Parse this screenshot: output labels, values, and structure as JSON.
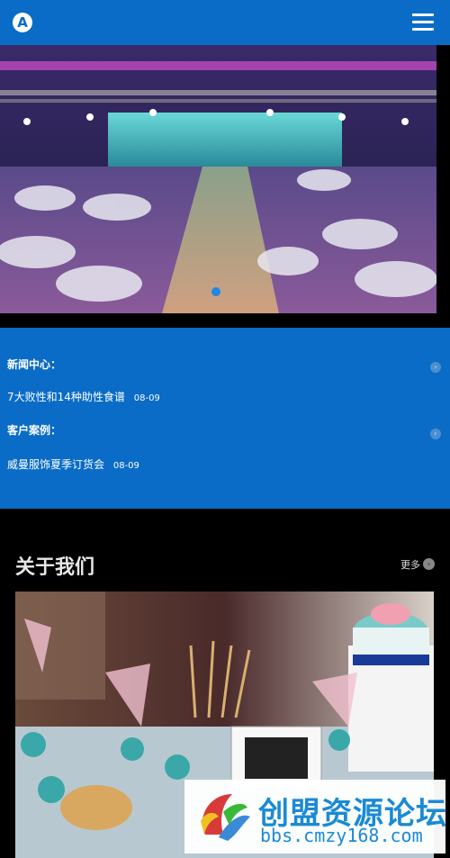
{
  "header": {
    "logo_letter": "A"
  },
  "news_block": {
    "news_center_label": "新闻中心：",
    "news_item": {
      "title": "7大败性和14种助性食谱",
      "date": "08-09"
    },
    "cases_label": "客户案例：",
    "case_item": {
      "title": "威曼服饰夏季订货会",
      "date": "08-09"
    }
  },
  "about": {
    "title": "关于我们",
    "more_label": "更多"
  },
  "watermark": {
    "title": "创盟资源论坛",
    "url": "bbs.cmzy168.com"
  },
  "colors": {
    "brand_blue": "#0a6cc6",
    "background": "#000000"
  },
  "icons": [
    "logo-icon",
    "menu-icon",
    "chevron-right-icon",
    "more-arrow-icon"
  ]
}
